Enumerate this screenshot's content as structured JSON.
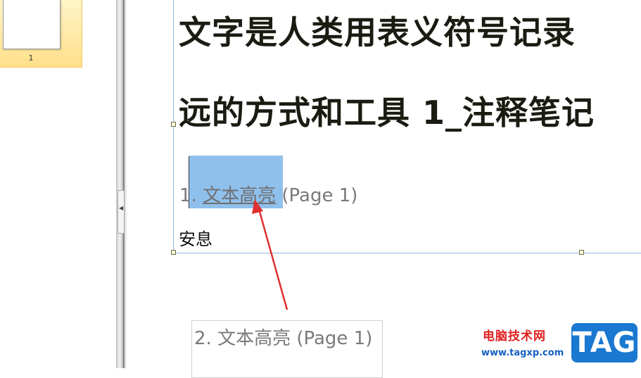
{
  "thumbnails": {
    "items": [
      {
        "page_number": "1",
        "selected": true
      }
    ]
  },
  "document": {
    "heading_line1": "文字是人类用表义符号记录",
    "heading_line2": "远的方式和工具 1_注释笔记",
    "annotation_entry": {
      "index": "1.",
      "label": "文本高亮",
      "page_ref": "(Page 1)"
    },
    "body_text": "安息"
  },
  "comment_popup": {
    "text": "2. 文本高亮  (Page 1)"
  },
  "watermark": {
    "site_name": "电脑技术网",
    "url": "www.tagxp.com",
    "badge": "TAG"
  },
  "colors": {
    "highlight": "#8fc0ec",
    "selection_border": "#8fb8e0",
    "arrow": "#e03030",
    "thumbnail_selected": "#ffe08a"
  }
}
